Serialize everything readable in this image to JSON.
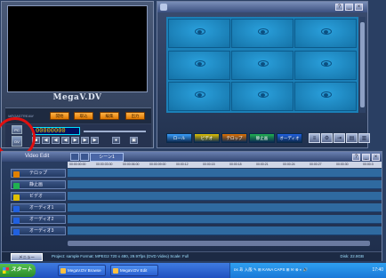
{
  "preview": {
    "logo": "MegaV.DV",
    "brand": "MEGASTREAM",
    "buttons": [
      "開始",
      "取込",
      "編集",
      "出力"
    ],
    "timecode": "00000000",
    "pc_label": "PC",
    "dv_label": "DV"
  },
  "library": {
    "title": "",
    "tabs": [
      {
        "label": "ロール",
        "color": "#3aa0ff"
      },
      {
        "label": "ビデオ",
        "color": "#e0c000"
      },
      {
        "label": "テロップ",
        "color": "#e07000"
      },
      {
        "label": "静止画",
        "color": "#20b050"
      },
      {
        "label": "オーディオ",
        "color": "#2060e0"
      }
    ]
  },
  "video_edit": {
    "title": "Video Edit",
    "scene_tab": "シーン1",
    "ruler_ticks": [
      "00:00:00:00",
      "00:00:03:00",
      "00:00:06:00",
      "00:00:09:00",
      "00:00:12",
      "00:00:15",
      "00:00:18",
      "00:00:21",
      "00:00:24",
      "00:00:27",
      "00:00:30",
      "00:00:3"
    ],
    "tracks": [
      {
        "label": "テロップ",
        "color": "#e08000"
      },
      {
        "label": "静止画",
        "color": "#20b050"
      },
      {
        "label": "ビデオ",
        "color": "#e0c000"
      },
      {
        "label": "オーディオ1",
        "color": "#2060e0"
      },
      {
        "label": "オーディオ2",
        "color": "#2060e0"
      },
      {
        "label": "オーディオ3",
        "color": "#2060e0"
      }
    ],
    "menu_button": "メニュー",
    "status": "Project: sample Format: MPEG2  720 x 480, 29.97fps (DVD Video) Scale: Full",
    "disk": "Disk: 22.8GB"
  },
  "taskbar": {
    "start": "スタート",
    "tasks": [
      "MegaV.DV Browse",
      "MegaV.DV Edit"
    ],
    "tray": "ᴅs あ 入般 ✎ ⊞ KANA CAPS   ⊞ ✉ ⊗ ◐ 🔊",
    "clock": "17:40"
  }
}
